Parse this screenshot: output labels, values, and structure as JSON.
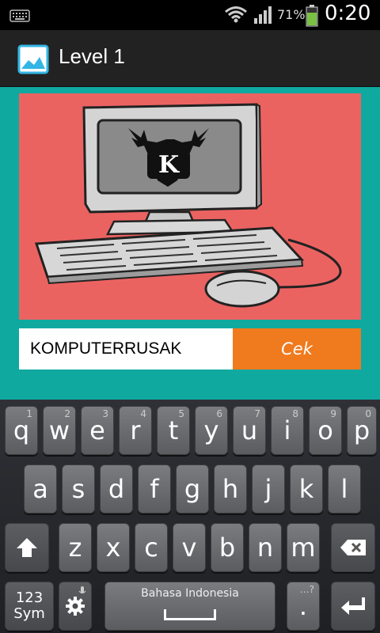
{
  "status_bar": {
    "battery_pct": "71%",
    "time": "0:20"
  },
  "action_bar": {
    "title": "Level 1"
  },
  "puzzle": {
    "monogram": "K"
  },
  "answer": {
    "value": "KOMPUTERRUSAK",
    "check_label": "Cek"
  },
  "keyboard": {
    "row1": [
      {
        "key": "q",
        "hint": "1"
      },
      {
        "key": "w",
        "hint": "2"
      },
      {
        "key": "e",
        "hint": "3"
      },
      {
        "key": "r",
        "hint": "4"
      },
      {
        "key": "t",
        "hint": "5"
      },
      {
        "key": "y",
        "hint": "6"
      },
      {
        "key": "u",
        "hint": "7"
      },
      {
        "key": "i",
        "hint": "8"
      },
      {
        "key": "o",
        "hint": "9"
      },
      {
        "key": "p",
        "hint": "0"
      }
    ],
    "row2": [
      "a",
      "s",
      "d",
      "f",
      "g",
      "h",
      "j",
      "k",
      "l"
    ],
    "row3": [
      "z",
      "x",
      "c",
      "v",
      "b",
      "n",
      "m"
    ],
    "sym_label_1": "123",
    "sym_label_2": "Sym",
    "space_label": "Bahasa Indonesia",
    "period": ".",
    "period_hint": "…?"
  }
}
